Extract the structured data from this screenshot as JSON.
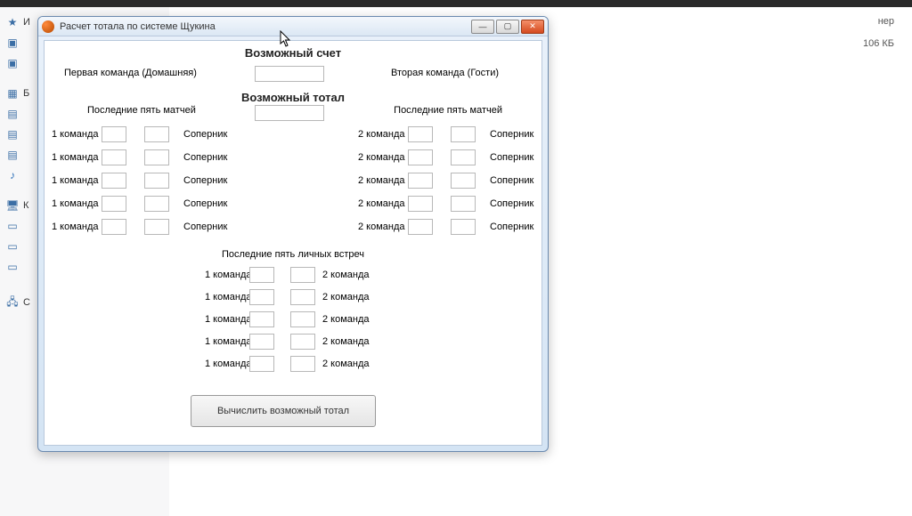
{
  "window": {
    "title": "Расчет тотала по системе Щукина",
    "section_score": "Возможный счет",
    "label_home": "Первая команда (Домашняя)",
    "label_away": "Вторая команда (Гости)",
    "section_total": "Возможный тотал",
    "last5_left": "Последние пять матчей",
    "last5_right": "Последние пять матчей",
    "team1": "1 команда",
    "team2": "2 команда",
    "opponent": "Соперник",
    "h2h_title": "Последние пять личных встреч",
    "calc_button": "Вычислить возможный тотал"
  },
  "explorer": {
    "top_item": "И",
    "block_b": "Б",
    "block_k": "К",
    "meta_label": "нер",
    "size": "106 КБ"
  }
}
